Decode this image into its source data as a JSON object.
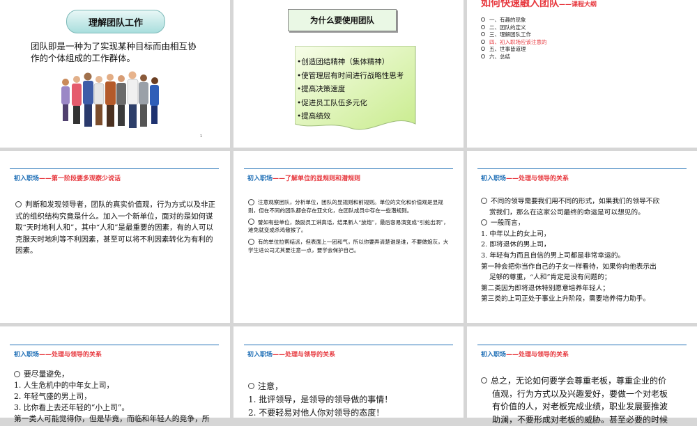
{
  "slide1": {
    "title": "理解团队工作",
    "body": "团队即是一种为了实现某种目标而由相互协作的个体组成的工作群体。",
    "page_number": "1"
  },
  "slide2": {
    "title": "为什么要使用团队",
    "items": [
      "•创造团结精神（集体精神）",
      "•使管理层有时间进行战略性思考",
      "•提高决策速度",
      "•促进员工队伍多元化",
      "•提高绩效"
    ]
  },
  "slide3": {
    "title": "如何快速融入团队",
    "subtitle": "——课程大纲",
    "items": [
      "一、有趣的现象",
      "二、团队的定义",
      "三、理解团队工作",
      "四、初入职场应该注意的",
      "五、世事皆道理",
      "六、总结"
    ]
  },
  "slide4": {
    "header_a": "初入职场",
    "header_b": "——第一阶段要多观察少说话",
    "body": "判断和发现领导者，团队的真实价值观，行为方式以及非正式的组织结构究竟是什么。加入一个新单位，面对的是如何谋取“天时地利人和”，其中“人和”是最重要的因素，有的人可以克服天时地利等不利因素，甚至可以将不利因素转化为有利的因素。"
  },
  "slide5": {
    "header_a": "初入职场",
    "header_b": "——了解单位的显规则和潜规则",
    "paras": [
      "注意观察团队，分析单位，团队的显规则和前规则。单位的文化和价值观是显规则，但在不同的团队都会存在亚文化，在团队成员中存在一些潜规则。",
      "譬如有些单位，鼓励员工讲真话，结果新人“放炮”，最后容易演变成“引蛇出洞”，难免就变成杀鸡儆猴了。",
      "有的单位拉帮结派，但表面上一团和气，所以你要弄清楚谁是谁，不要做炮灰，大学生进公司尤其要注意一点，要学会保护自己。"
    ]
  },
  "slide6": {
    "header_a": "初入职场",
    "header_b": "——处理与领导的关系",
    "lines": [
      "不同的领导需要我们用不同的形式，如果我们的领导不欣",
      "赏我们，那么在这家公司最终的命运是可以想见的。",
      "一般而言，",
      "1. 中年以上的女上司，",
      "2. 即将退休的男上司，",
      "3. 年轻有为而且自信的男上司都是非常幸运的。",
      "第一种会把你当作自己的子女一样看待，如果你向他表示出",
      "足够的尊重，“人和”肯定是没有问题的；",
      "第二类因为即将退休特别愿意培养年轻人；",
      "第三类的上司正处于事业上升阶段，需要培养得力助手。"
    ]
  },
  "slide7": {
    "header_a": "初入职场",
    "header_b": "——处理与领导的关系",
    "lines": [
      "要尽量避免，",
      "1. 人生危机中的中年女上司，",
      "2. 年轻气盛的男上司，",
      "3. 比你看上去还年轻的“小上司”。",
      "第一类人可能觉得你，但是毕竟，而临和年轻人的竞争，所"
    ]
  },
  "slide8": {
    "header_a": "初入职场",
    "header_b": "——处理与领导的关系",
    "lines": [
      "注意，",
      "1. 批评领导，是领导的领导做的事情！",
      "2. 不要轻易对他人你对领导的态度！"
    ]
  },
  "slide9": {
    "header_a": "初入职场",
    "header_b": "——处理与领导的关系",
    "lines": [
      "总之，无论如何要学会尊重老板，尊重企业的价",
      "值观，行为方式以及兴趣爱好，要做一个对老板",
      "有价值的人，对老板完成业绩，职业发展要推波",
      "助澜，不要形成对老板的威胁。甚至必要的时候"
    ]
  }
}
